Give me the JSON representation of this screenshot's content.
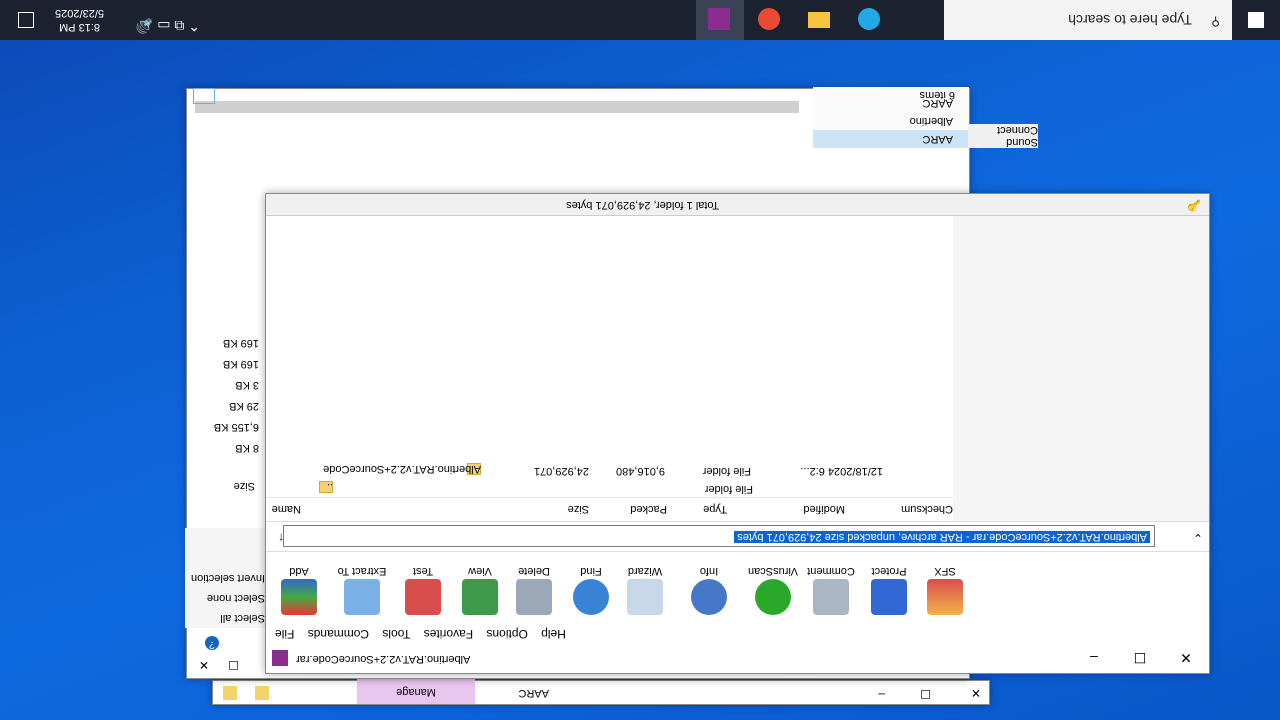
{
  "explorer": {
    "manage_tab": "Manage",
    "address": "AARC",
    "ribbon": [
      "Select all",
      "Select none",
      "Invert selection"
    ],
    "size_header": "Size",
    "sizes": [
      "8 KB",
      "6,155 KB",
      "29 KB",
      "3 KB",
      "169 KB",
      "169 KB"
    ],
    "tree": [
      "AARC",
      "Albertino",
      "AARC"
    ],
    "status_items": "6 items",
    "sound_items": [
      "Sound",
      "Connect"
    ]
  },
  "winrar": {
    "title": "Albertino.RAT.v2.2+SourceCode.rar",
    "menu": [
      "File",
      "Commands",
      "Tools",
      "Favorites",
      "Options",
      "Help"
    ],
    "toolbar": [
      "Add",
      "Extract To",
      "Test",
      "View",
      "Delete",
      "Find",
      "Wizard",
      "Info",
      "VirusScan",
      "Comment",
      "Protect",
      "SFX"
    ],
    "address_text": "Albertino.RAT.v2.2+SourceCode.rar - RAR archive, unpacked size 24,929,071 bytes",
    "columns": [
      "Name",
      "Size",
      "Packed",
      "Type",
      "Modified",
      "Checksum"
    ],
    "rows": [
      {
        "name": "..",
        "size": "",
        "packed": "",
        "type": "File folder",
        "modified": ""
      },
      {
        "name": "Albertino.RAT.v2.2+SourceCode",
        "size": "24,929,071",
        "packed": "9,016,480",
        "type": "File folder",
        "modified": "12/18/2024 6:2..."
      }
    ],
    "status": "Total 1 folder, 24,929,071 bytes"
  },
  "taskbar": {
    "search_placeholder": "Type here to search",
    "time": "8:13 PM",
    "date": "5/23/2025"
  },
  "colors": {
    "taskbar": "#1c2230",
    "desktop": "#0e6ae0",
    "selection": "#0a64d6"
  }
}
